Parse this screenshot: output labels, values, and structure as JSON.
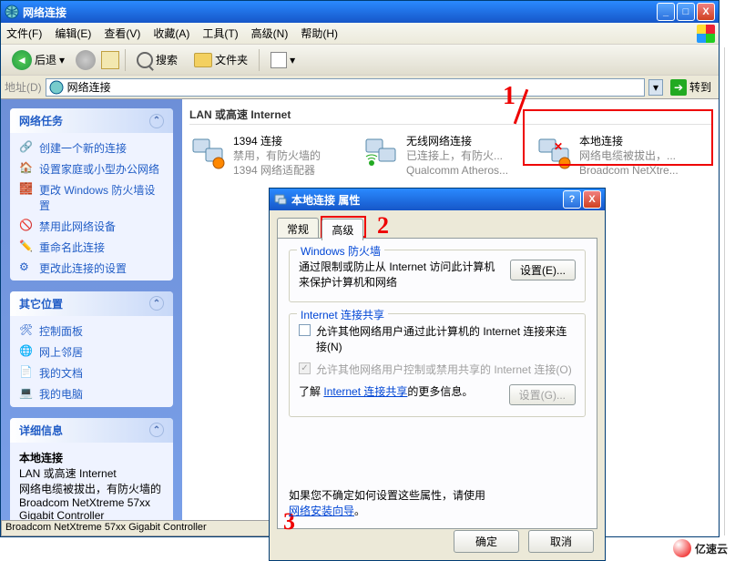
{
  "window": {
    "title": "网络连接",
    "controls": {
      "min": "_",
      "max": "□",
      "close": "X"
    }
  },
  "menu": {
    "file": "文件(F)",
    "edit": "编辑(E)",
    "view": "查看(V)",
    "fav": "收藏(A)",
    "tools": "工具(T)",
    "adv": "高级(N)",
    "help": "帮助(H)"
  },
  "toolbar": {
    "back": "后退",
    "search": "搜索",
    "folders": "文件夹"
  },
  "addressbar": {
    "label": "地址(D)",
    "value": "网络连接",
    "go": "转到"
  },
  "sidebar": {
    "tasks": {
      "title": "网络任务",
      "items": [
        "创建一个新的连接",
        "设置家庭或小型办公网络",
        "更改 Windows 防火墙设置",
        "禁用此网络设备",
        "重命名此连接",
        "更改此连接的设置"
      ]
    },
    "other": {
      "title": "其它位置",
      "items": [
        "控制面板",
        "网上邻居",
        "我的文档",
        "我的电脑"
      ]
    },
    "details": {
      "title": "详细信息",
      "name": "本地连接",
      "type": "LAN 或高速 Internet",
      "status": "网络电缆被拔出，有防火墙的",
      "device": "Broadcom NetXtreme 57xx Gigabit Controller"
    }
  },
  "main": {
    "category": "LAN 或高速 Internet",
    "connections": [
      {
        "name": "1394 连接",
        "status": "禁用，有防火墙的",
        "device": "1394 网络适配器"
      },
      {
        "name": "无线网络连接",
        "status": "已连接上，有防火...",
        "device": "Qualcomm Atheros..."
      },
      {
        "name": "本地连接",
        "status": "网络电缆被拔出，...",
        "device": "Broadcom NetXtre..."
      }
    ]
  },
  "annotations": {
    "a1": "1",
    "a2": "2",
    "a3": "3"
  },
  "dialog": {
    "title": "本地连接 属性",
    "tabs": {
      "general": "常规",
      "advanced": "高级"
    },
    "firewall": {
      "title": "Windows 防火墙",
      "text": "通过限制或防止从 Internet 访问此计算机来保护计算机和网络",
      "btn": "设置(E)..."
    },
    "ics": {
      "title": "Internet 连接共享",
      "chk1": "允许其他网络用户通过此计算机的 Internet 连接来连接(N)",
      "chk2": "允许其他网络用户控制或禁用共享的 Internet 连接(O)",
      "learnpre": "了解",
      "learnlink": "Internet 连接共享",
      "learnpost": "的更多信息。",
      "setbtn": "设置(G)..."
    },
    "note": {
      "pre": "如果您不确定如何设置这些属性，请使用",
      "link": "网络安装向导",
      "post": "。"
    },
    "ok": "确定",
    "cancel": "取消"
  },
  "statusbar": "Broadcom NetXtreme 57xx Gigabit Controller",
  "watermark": "亿速云"
}
